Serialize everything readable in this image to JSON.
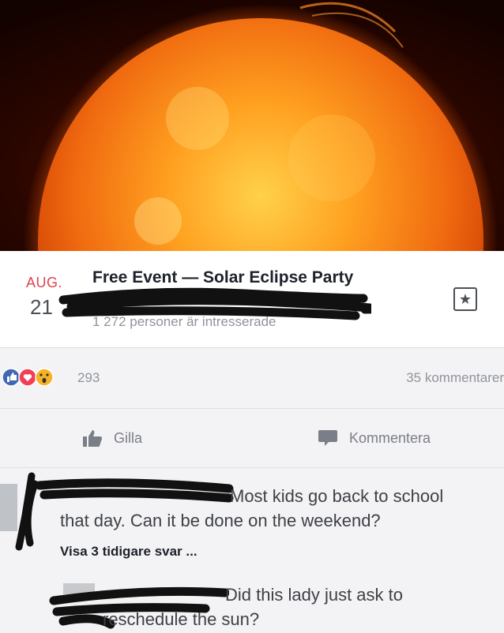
{
  "event": {
    "month": "AUG.",
    "day": "21",
    "title": "Free Event — Solar Eclipse Party",
    "subtitle": "1 272 personer är intresserade"
  },
  "reactions": {
    "count": "293",
    "comments": "35 kommentarer",
    "icons": [
      "like-icon",
      "love-icon",
      "wow-icon"
    ]
  },
  "actions": {
    "like": "Gilla",
    "comment": "Kommentera"
  },
  "comments": [
    {
      "text_first": "Most kids go back to school",
      "text_rest": "that day. Can it be done on the weekend?"
    },
    {
      "text_first": "Did this lady just ask to",
      "text_rest": "reschedule the sun?"
    }
  ],
  "show_replies": "Visa 3 tidigare svar ...",
  "colors": {
    "accent": "#e0414f",
    "like": "#4267b2",
    "love": "#f33e58",
    "wow": "#f7b125"
  }
}
